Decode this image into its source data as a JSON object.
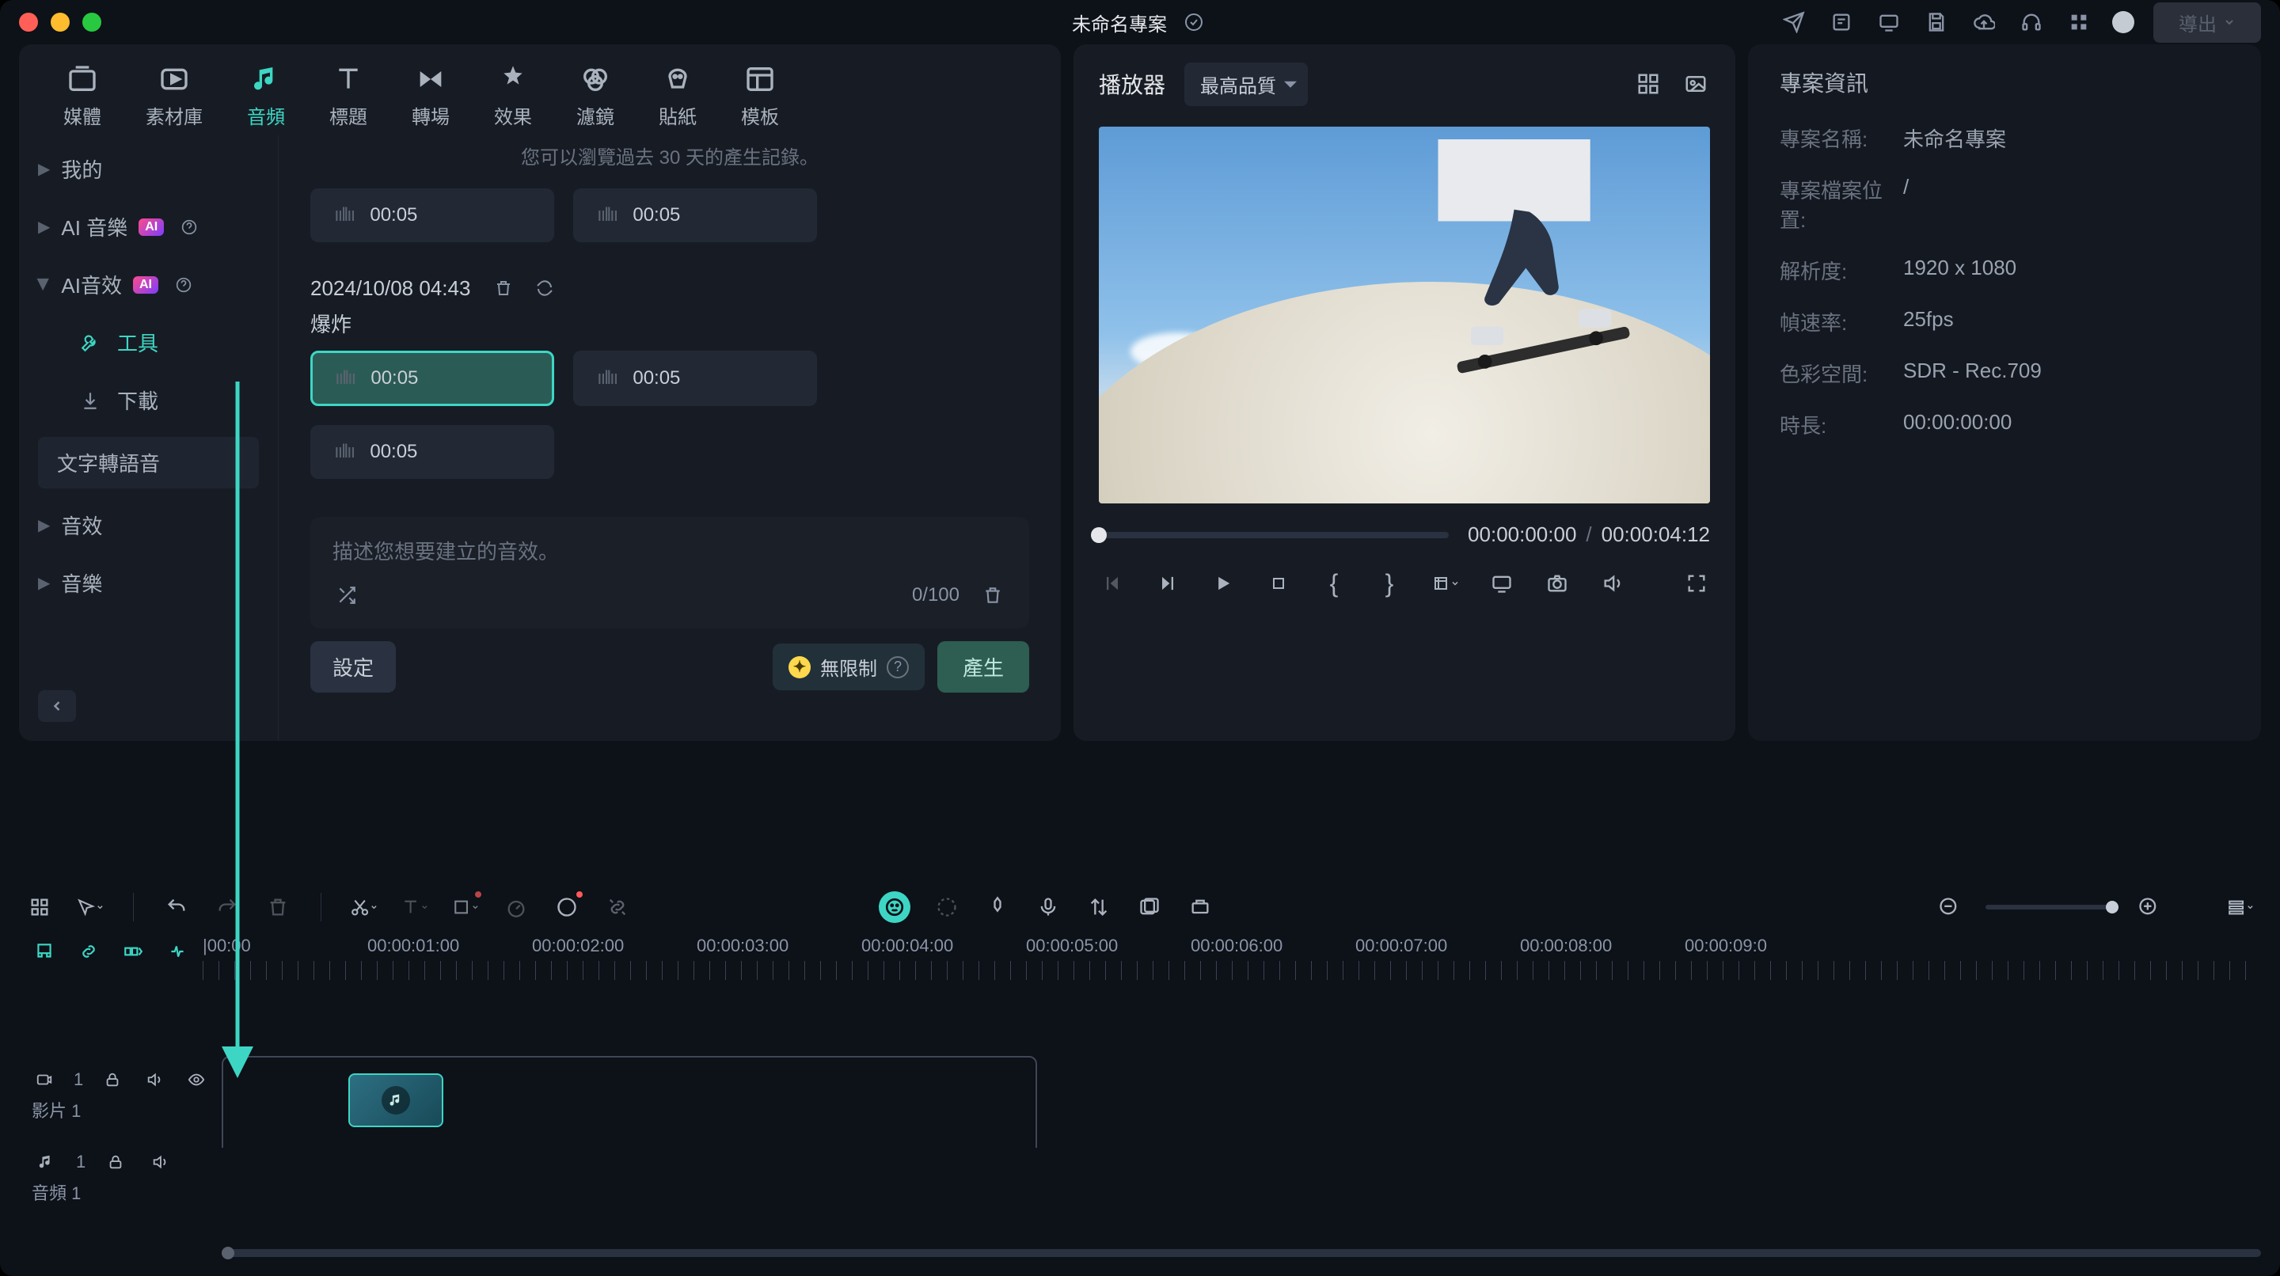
{
  "titlebar": {
    "project_name": "未命名專案",
    "export_label": "導出"
  },
  "top_tabs": [
    {
      "id": "media",
      "label": "媒體"
    },
    {
      "id": "stock",
      "label": "素材庫"
    },
    {
      "id": "audio",
      "label": "音頻",
      "active": true
    },
    {
      "id": "titles",
      "label": "標題"
    },
    {
      "id": "transitions",
      "label": "轉場"
    },
    {
      "id": "effects",
      "label": "效果"
    },
    {
      "id": "filters",
      "label": "濾鏡"
    },
    {
      "id": "stickers",
      "label": "貼紙"
    },
    {
      "id": "templates",
      "label": "模板"
    }
  ],
  "side": {
    "mine": "我的",
    "ai_music": "AI 音樂",
    "ai_sfx": "AI音效",
    "tool": "工具",
    "download": "下載",
    "tts": "文字轉語音",
    "sfx": "音效",
    "music": "音樂"
  },
  "content": {
    "hint": "您可以瀏覽過去 30 天的產生記錄。",
    "chip_duration": "00:05",
    "gen_datetime": "2024/10/08 04:43",
    "gen_label": "爆炸",
    "prompt_placeholder": "描述您想要建立的音效。",
    "char_count": "0/100",
    "settings_label": "設定",
    "unlimited_label": "無限制",
    "generate_label": "產生"
  },
  "player": {
    "title": "播放器",
    "quality": "最高品質",
    "current_time": "00:00:00:00",
    "total_time": "00:00:04:12"
  },
  "info": {
    "title": "專案資訊",
    "name_k": "專案名稱:",
    "name_v": "未命名專案",
    "file_k": "專案檔案位置:",
    "file_v": "/",
    "res_k": "解析度:",
    "res_v": "1920 x 1080",
    "fps_k": "幀速率:",
    "fps_v": "25fps",
    "cs_k": "色彩空間:",
    "cs_v": "SDR - Rec.709",
    "dur_k": "時長:",
    "dur_v": "00:00:00:00"
  },
  "ruler": [
    "|00:00",
    "00:00:01:00",
    "00:00:02:00",
    "00:00:03:00",
    "00:00:04:00",
    "00:00:05:00",
    "00:00:06:00",
    "00:00:07:00",
    "00:00:08:00",
    "00:00:09:0"
  ],
  "tracks": {
    "video_num": "1",
    "video_label": "影片 1",
    "audio_num": "1",
    "audio_label": "音頻 1"
  }
}
